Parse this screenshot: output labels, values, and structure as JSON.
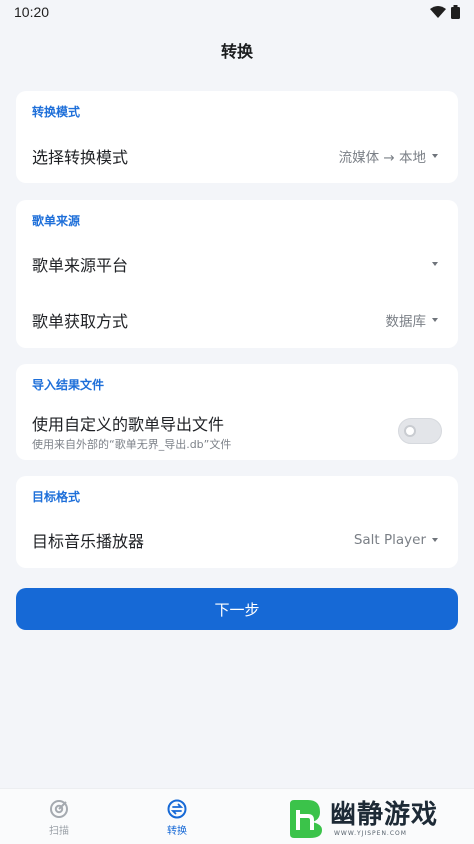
{
  "status_bar": {
    "time": "10:20"
  },
  "header": {
    "title": "转换"
  },
  "sections": {
    "mode": {
      "title": "转换模式",
      "row_label": "选择转换模式",
      "row_value": "流媒体 → 本地"
    },
    "source": {
      "title": "歌单来源",
      "platform_label": "歌单来源平台",
      "platform_value": "",
      "method_label": "歌单获取方式",
      "method_value": "数据库"
    },
    "import": {
      "title": "导入结果文件",
      "toggle_label": "使用自定义的歌单导出文件",
      "toggle_sub": "使用来自外部的“歌单无界_导出.db”文件",
      "toggle_on": false
    },
    "target": {
      "title": "目标格式",
      "player_label": "目标音乐播放器",
      "player_value": "Salt Player"
    }
  },
  "next_button": {
    "label": "下一步"
  },
  "bottom_nav": {
    "items": [
      {
        "label": "扫描",
        "icon": "scan-icon",
        "active": false
      },
      {
        "label": "转换",
        "icon": "convert-icon",
        "active": true
      }
    ]
  },
  "watermark": {
    "brand": "幽静游戏",
    "url": "WWW.YJISPEN.COM"
  },
  "colors": {
    "accent": "#1669d6",
    "background": "#f3f5f9",
    "section_title": "#1e6fd9"
  }
}
